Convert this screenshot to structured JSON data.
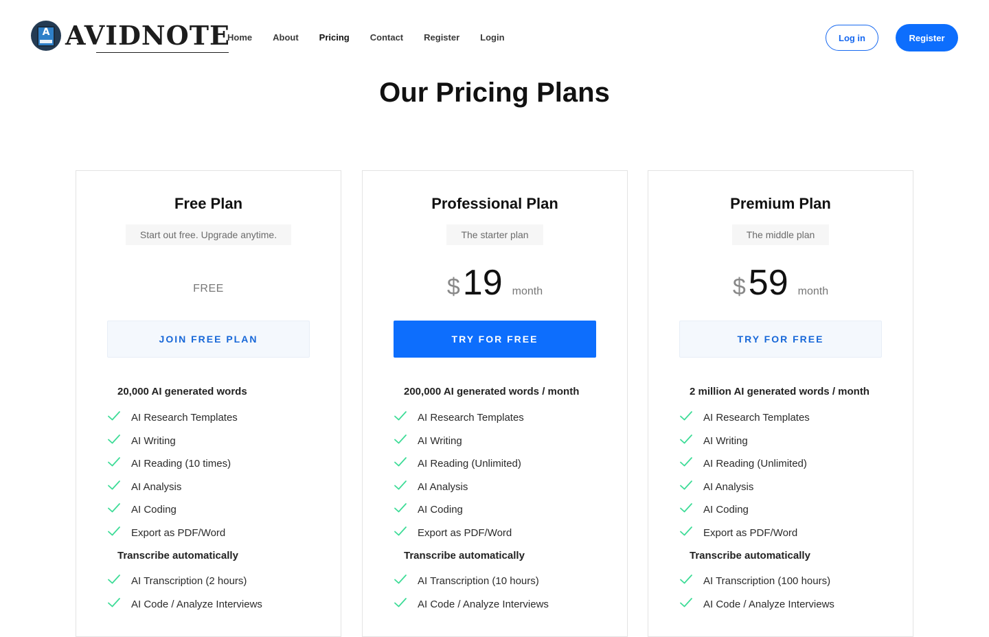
{
  "brand": {
    "name": "AVIDNOTE",
    "badge_letter": "A"
  },
  "nav": {
    "items": [
      {
        "label": "Home",
        "active": false
      },
      {
        "label": "About",
        "active": false
      },
      {
        "label": "Pricing",
        "active": true
      },
      {
        "label": "Contact",
        "active": false
      },
      {
        "label": "Register",
        "active": false
      },
      {
        "label": "Login",
        "active": false
      }
    ],
    "login_button": "Log in",
    "register_button": "Register"
  },
  "page": {
    "title": "Our Pricing Plans"
  },
  "colors": {
    "primary": "#0d6efd",
    "check": "#3ddc97",
    "light_button_bg": "#f4f8fd"
  },
  "plans": [
    {
      "name": "Free Plan",
      "subtitle": "Start out free. Upgrade anytime.",
      "price_text": "FREE",
      "cta": "JOIN FREE PLAN",
      "words_heading": "20,000 AI generated words",
      "features": [
        "AI Research Templates",
        "AI Writing",
        "AI Reading (10 times)",
        "AI Analysis",
        "AI Coding",
        "Export as PDF/Word"
      ],
      "transcribe_heading": "Transcribe automatically",
      "transcribe_features": [
        "AI Transcription (2 hours)",
        "AI Code / Analyze Interviews"
      ]
    },
    {
      "name": "Professional Plan",
      "subtitle": "The starter plan",
      "currency": "$",
      "amount": "19",
      "period": "month",
      "cta": "TRY FOR FREE",
      "words_heading": "200,000 AI generated words / month",
      "features": [
        "AI Research Templates",
        "AI Writing",
        "AI Reading (Unlimited)",
        "AI Analysis",
        "AI Coding",
        "Export as PDF/Word"
      ],
      "transcribe_heading": "Transcribe automatically",
      "transcribe_features": [
        "AI Transcription (10 hours)",
        "AI Code / Analyze Interviews"
      ]
    },
    {
      "name": "Premium Plan",
      "subtitle": "The middle plan",
      "currency": "$",
      "amount": "59",
      "period": "month",
      "cta": "TRY FOR FREE",
      "words_heading": "2 million AI generated words / month",
      "features": [
        "AI Research Templates",
        "AI Writing",
        "AI Reading (Unlimited)",
        "AI Analysis",
        "AI Coding",
        "Export as PDF/Word"
      ],
      "transcribe_heading": "Transcribe automatically",
      "transcribe_features": [
        "AI Transcription (100 hours)",
        "AI Code / Analyze Interviews"
      ]
    }
  ]
}
